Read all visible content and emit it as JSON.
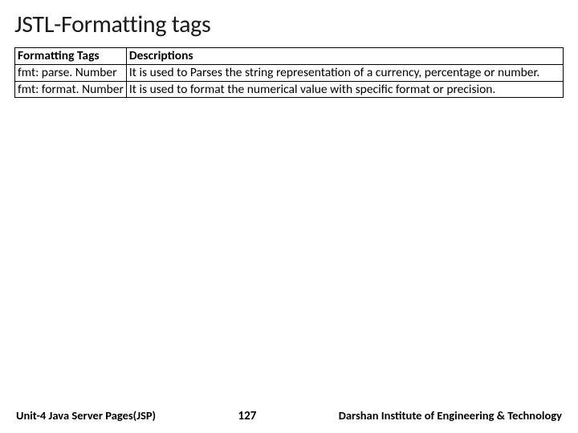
{
  "title": "JSTL-Formatting tags",
  "table": {
    "headers": {
      "tag": "Formatting Tags",
      "desc": "Descriptions"
    },
    "rows": [
      {
        "tag": "fmt: parse. Number",
        "desc": "It is used to Parses the string representation of a currency, percentage or number."
      },
      {
        "tag": "fmt: format. Number",
        "desc": "It is used to format the numerical value with specific format or precision."
      }
    ]
  },
  "footer": {
    "left": "Unit-4 Java Server Pages(JSP)",
    "center": "127",
    "right": "Darshan Institute of Engineering & Technology"
  }
}
